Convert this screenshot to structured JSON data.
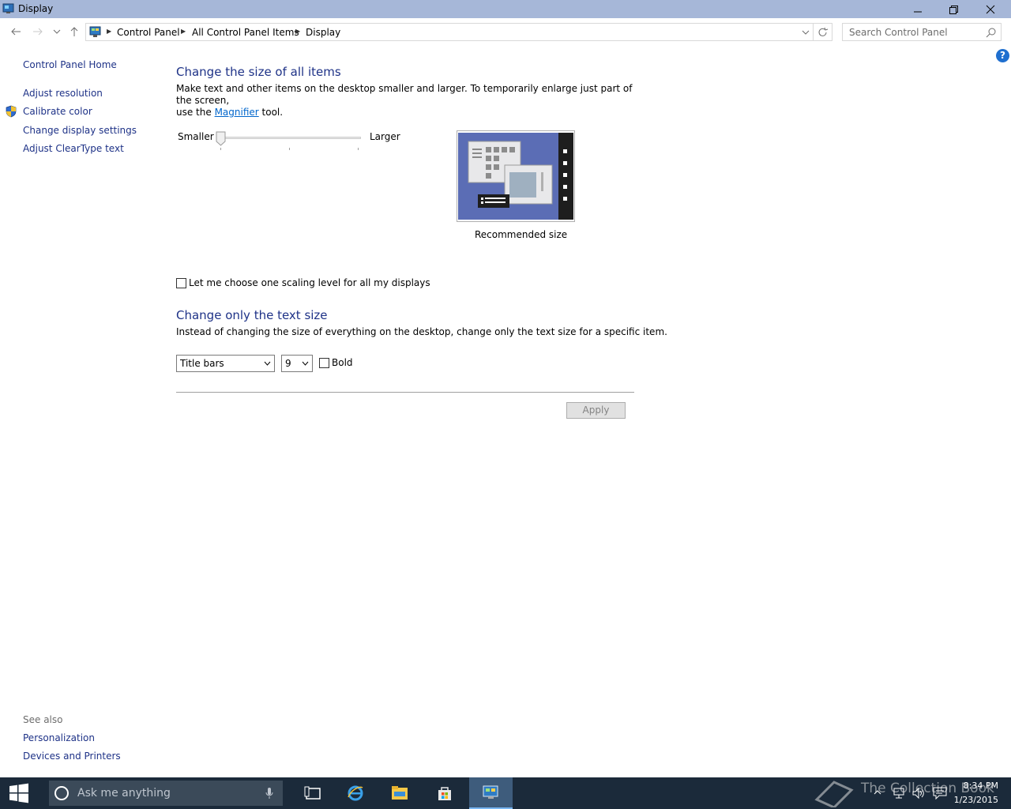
{
  "window": {
    "title": "Display"
  },
  "navigation": {
    "breadcrumbs": [
      "Control Panel",
      "All Control Panel Items",
      "Display"
    ],
    "search_placeholder": "Search Control Panel"
  },
  "sidebar": {
    "home": "Control Panel Home",
    "items": [
      {
        "label": "Adjust resolution"
      },
      {
        "label": "Calibrate color",
        "icon": "shield-icon"
      },
      {
        "label": "Change display settings"
      },
      {
        "label": "Adjust ClearType text"
      }
    ],
    "see_also_heading": "See also",
    "see_also": [
      "Personalization",
      "Devices and Printers"
    ]
  },
  "main": {
    "size_heading": "Change the size of all items",
    "size_desc_line1": "Make text and other items on the desktop smaller and larger. To temporarily enlarge just part of the screen,",
    "size_desc_pre": "use the",
    "size_desc_link": "Magnifier",
    "size_desc_post": "tool.",
    "slider_smaller": "Smaller",
    "slider_larger": "Larger",
    "slider_position": 0,
    "preview_caption": "Recommended size",
    "scaling_checkbox_label": "Let me choose one scaling level for all my displays",
    "scaling_checkbox_checked": false,
    "text_heading": "Change only the text size",
    "text_desc": "Instead of changing the size of everything on the desktop, change only the text size for a specific item.",
    "item_select": "Title bars",
    "size_select": "9",
    "bold_label": "Bold",
    "bold_checked": false,
    "apply_label": "Apply"
  },
  "taskbar": {
    "search_placeholder": "Ask me anything",
    "time": "8:34 PM",
    "date": "1/23/2015",
    "watermark": "The Collection Book"
  },
  "colors": {
    "titlebar": "#a6b7d8",
    "link": "#1e3287",
    "taskbar": "#1b2a3a"
  }
}
